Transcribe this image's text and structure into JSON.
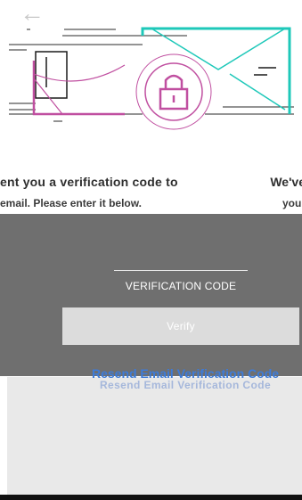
{
  "header": {
    "back_icon": "arrow-left-icon",
    "back_glyph": "←"
  },
  "hero": {
    "illustration": "envelope-with-lock-icon",
    "accent": "#1ec8b9",
    "lock_color": "#c04fa0"
  },
  "message": {
    "line1": "ent you a verification code to",
    "line1_right": "We've",
    "line2": "email. Please enter it below.",
    "line2_right": "your"
  },
  "form": {
    "code_label": "VERIFICATION CODE",
    "verify_label": "Verify",
    "resend_label": "Resend Email Verification Code"
  },
  "colors": {
    "panel": "#6f6f6f",
    "verify_bg": "#dcdcdc",
    "link": "#3d7bd8",
    "lower_panel": "#e9e9e9"
  }
}
